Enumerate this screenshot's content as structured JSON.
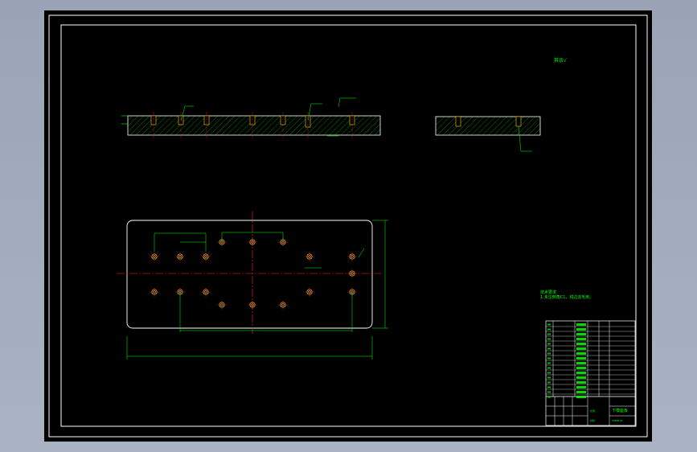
{
  "colors": {
    "background": "#000000",
    "frame": "#ffffff",
    "dimension": "#00ff00",
    "centerline": "#ff2020",
    "hole": "#ffcc00",
    "hatch": "#00aa00"
  },
  "drawing": {
    "roughness_mark": "其余",
    "roughness_value": "√",
    "tech_notes_title": "技术要求",
    "tech_notes_line": "1.未注倒角C1，锐边去毛刺。"
  },
  "title_block": {
    "part_name": "下模座板",
    "drawing_no": "XMZB-01",
    "scale_label": "比例",
    "material_label": "材料"
  }
}
